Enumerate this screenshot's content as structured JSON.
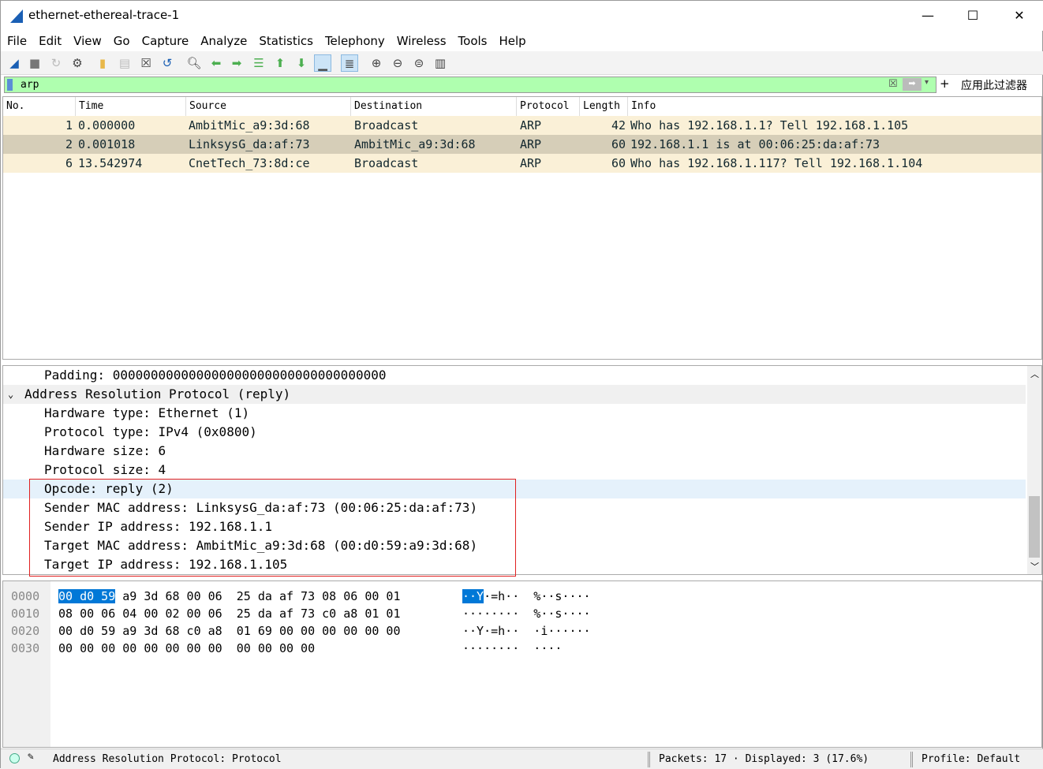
{
  "window": {
    "title": "ethernet-ethereal-trace-1",
    "minimize": "—",
    "maximize": "☐",
    "close": "✕"
  },
  "menu": [
    "File",
    "Edit",
    "View",
    "Go",
    "Capture",
    "Analyze",
    "Statistics",
    "Telephony",
    "Wireless",
    "Tools",
    "Help"
  ],
  "toolbar": [
    "shark-fin-start",
    "stop",
    "restart",
    "options",
    "open",
    "save",
    "close",
    "reload",
    "find",
    "back",
    "forward",
    "go-to",
    "first",
    "last",
    "autoscroll",
    "colorize",
    "zoom-in",
    "zoom-out",
    "zoom-normal",
    "resize-columns"
  ],
  "filter": {
    "value": "arp",
    "apply_label": "应用此过滤器",
    "plus": "+",
    "bg": "#afffaf"
  },
  "packet_list": {
    "columns": [
      "No.",
      "Time",
      "Source",
      "Destination",
      "Protocol",
      "Length",
      "Info"
    ],
    "rows": [
      {
        "no": "1",
        "time": "0.000000",
        "source": "AmbitMic_a9:3d:68",
        "destination": "Broadcast",
        "protocol": "ARP",
        "length": "42",
        "info": "Who has 192.168.1.1? Tell 192.168.1.105",
        "bg": "#faf0d7"
      },
      {
        "no": "2",
        "time": "0.001018",
        "source": "LinksysG_da:af:73",
        "destination": "AmbitMic_a9:3d:68",
        "protocol": "ARP",
        "length": "60",
        "info": "192.168.1.1 is at 00:06:25:da:af:73",
        "bg": "#d6ceb8"
      },
      {
        "no": "6",
        "time": "13.542974",
        "source": "CnetTech_73:8d:ce",
        "destination": "Broadcast",
        "protocol": "ARP",
        "length": "60",
        "info": "Who has 192.168.1.117? Tell 192.168.1.104",
        "bg": "#faf0d7"
      }
    ]
  },
  "details": {
    "padding": "Padding: 000000000000000000000000000000000000",
    "arp_header": "Address Resolution Protocol (reply)",
    "fields": [
      "Hardware type: Ethernet (1)",
      "Protocol type: IPv4 (0x0800)",
      "Hardware size: 6",
      "Protocol size: 4",
      "Opcode: reply (2)",
      "Sender MAC address: LinksysG_da:af:73 (00:06:25:da:af:73)",
      "Sender IP address: 192.168.1.1",
      "Target MAC address: AmbitMic_a9:3d:68 (00:d0:59:a9:3d:68)",
      "Target IP address: 192.168.1.105"
    ]
  },
  "bytes": [
    {
      "offset": "0000",
      "sel": "00 d0 59",
      "hex": " a9 3d 68 00 06  25 da af 73 08 06 00 01",
      "asel": "··Y",
      "ascii": "·=h··  %··s····"
    },
    {
      "offset": "0010",
      "sel": "",
      "hex": "08 00 06 04 00 02 00 06  25 da af 73 c0 a8 01 01",
      "asel": "",
      "ascii": "········  %··s····"
    },
    {
      "offset": "0020",
      "sel": "",
      "hex": "00 d0 59 a9 3d 68 c0 a8  01 69 00 00 00 00 00 00",
      "asel": "",
      "ascii": "··Y·=h··  ·i······"
    },
    {
      "offset": "0030",
      "sel": "",
      "hex": "00 00 00 00 00 00 00 00  00 00 00 00",
      "asel": "",
      "ascii": "········  ····"
    }
  ],
  "status": {
    "left": "Address Resolution Protocol: Protocol",
    "packets": "Packets: 17 · Displayed: 3 (17.6%)",
    "profile": "Profile: Default"
  }
}
